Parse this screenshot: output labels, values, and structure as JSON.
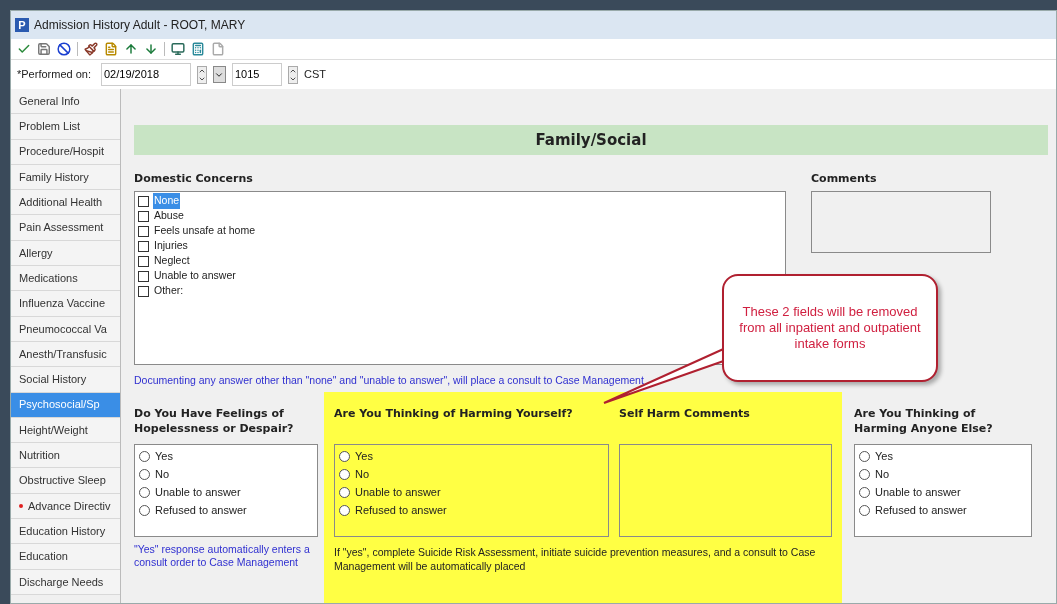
{
  "window": {
    "title": "Admission History Adult - ROOT, MARY",
    "app_letter": "P"
  },
  "performed": {
    "label": "*Performed on:",
    "date": "02/19/2018",
    "time": "1015",
    "zone": "CST"
  },
  "sidebar": {
    "items": [
      {
        "label": "General Info",
        "selected": false,
        "flagged": false
      },
      {
        "label": "Problem List",
        "selected": false,
        "flagged": false
      },
      {
        "label": "Procedure/Hospit",
        "selected": false,
        "flagged": false
      },
      {
        "label": "Family History",
        "selected": false,
        "flagged": false
      },
      {
        "label": "Additional Health",
        "selected": false,
        "flagged": false
      },
      {
        "label": "Pain Assessment",
        "selected": false,
        "flagged": false
      },
      {
        "label": "Allergy",
        "selected": false,
        "flagged": false
      },
      {
        "label": "Medications",
        "selected": false,
        "flagged": false
      },
      {
        "label": "Influenza Vaccine",
        "selected": false,
        "flagged": false
      },
      {
        "label": "Pneumococcal Va",
        "selected": false,
        "flagged": false
      },
      {
        "label": "Anesth/Transfusic",
        "selected": false,
        "flagged": false
      },
      {
        "label": "Social History",
        "selected": false,
        "flagged": false
      },
      {
        "label": "Psychosocial/Sp",
        "selected": true,
        "flagged": false
      },
      {
        "label": "Height/Weight",
        "selected": false,
        "flagged": false
      },
      {
        "label": "Nutrition",
        "selected": false,
        "flagged": false
      },
      {
        "label": "Obstructive Sleep",
        "selected": false,
        "flagged": false
      },
      {
        "label": "Advance Directiv",
        "selected": false,
        "flagged": true
      },
      {
        "label": "Education History",
        "selected": false,
        "flagged": false
      },
      {
        "label": "Education",
        "selected": false,
        "flagged": false
      },
      {
        "label": "Discharge Needs",
        "selected": false,
        "flagged": false
      }
    ]
  },
  "section_title": "Family/Social",
  "domestic": {
    "label": "Domestic Concerns",
    "options": [
      {
        "label": "None",
        "checked": false,
        "highlighted": true
      },
      {
        "label": "Abuse",
        "checked": false,
        "highlighted": false
      },
      {
        "label": "Feels unsafe at home",
        "checked": false,
        "highlighted": false
      },
      {
        "label": "Injuries",
        "checked": false,
        "highlighted": false
      },
      {
        "label": "Neglect",
        "checked": false,
        "highlighted": false
      },
      {
        "label": "Unable to answer",
        "checked": false,
        "highlighted": false
      },
      {
        "label": "Other:",
        "checked": false,
        "highlighted": false
      }
    ]
  },
  "comments": {
    "label": "Comments"
  },
  "domestic_note": "Documenting any answer other than \"none\" and \"unable to answer\", will place a consult to Case Management",
  "hopelessness": {
    "label": "Do You Have Feelings of Hopelessness or Despair?",
    "options": [
      {
        "label": "Yes",
        "selected": false
      },
      {
        "label": "No",
        "selected": false
      },
      {
        "label": "Unable to answer",
        "selected": false
      },
      {
        "label": "Refused to answer",
        "selected": false
      }
    ],
    "note": "\"Yes\" response automatically enters a consult order to Case Management"
  },
  "harm_self": {
    "label": "Are You Thinking of Harming Yourself?",
    "options": [
      {
        "label": "Yes",
        "selected": false
      },
      {
        "label": "No",
        "selected": false
      },
      {
        "label": "Unable to answer",
        "selected": false
      },
      {
        "label": "Refused to answer",
        "selected": false
      }
    ]
  },
  "self_harm_comments": {
    "label": "Self Harm Comments"
  },
  "harm_note": "If \"yes\", complete Suicide Risk Assessment, initiate suicide prevention measures, and a consult to Case Management will be automatically placed",
  "harm_others": {
    "label": "Are You Thinking of Harming Anyone Else?",
    "options": [
      {
        "label": "Yes",
        "selected": false
      },
      {
        "label": "No",
        "selected": false
      },
      {
        "label": "Unable to answer",
        "selected": false
      },
      {
        "label": "Refused to answer",
        "selected": false
      }
    ]
  },
  "callout": "These 2 fields will be removed from all inpatient and outpatient intake forms"
}
